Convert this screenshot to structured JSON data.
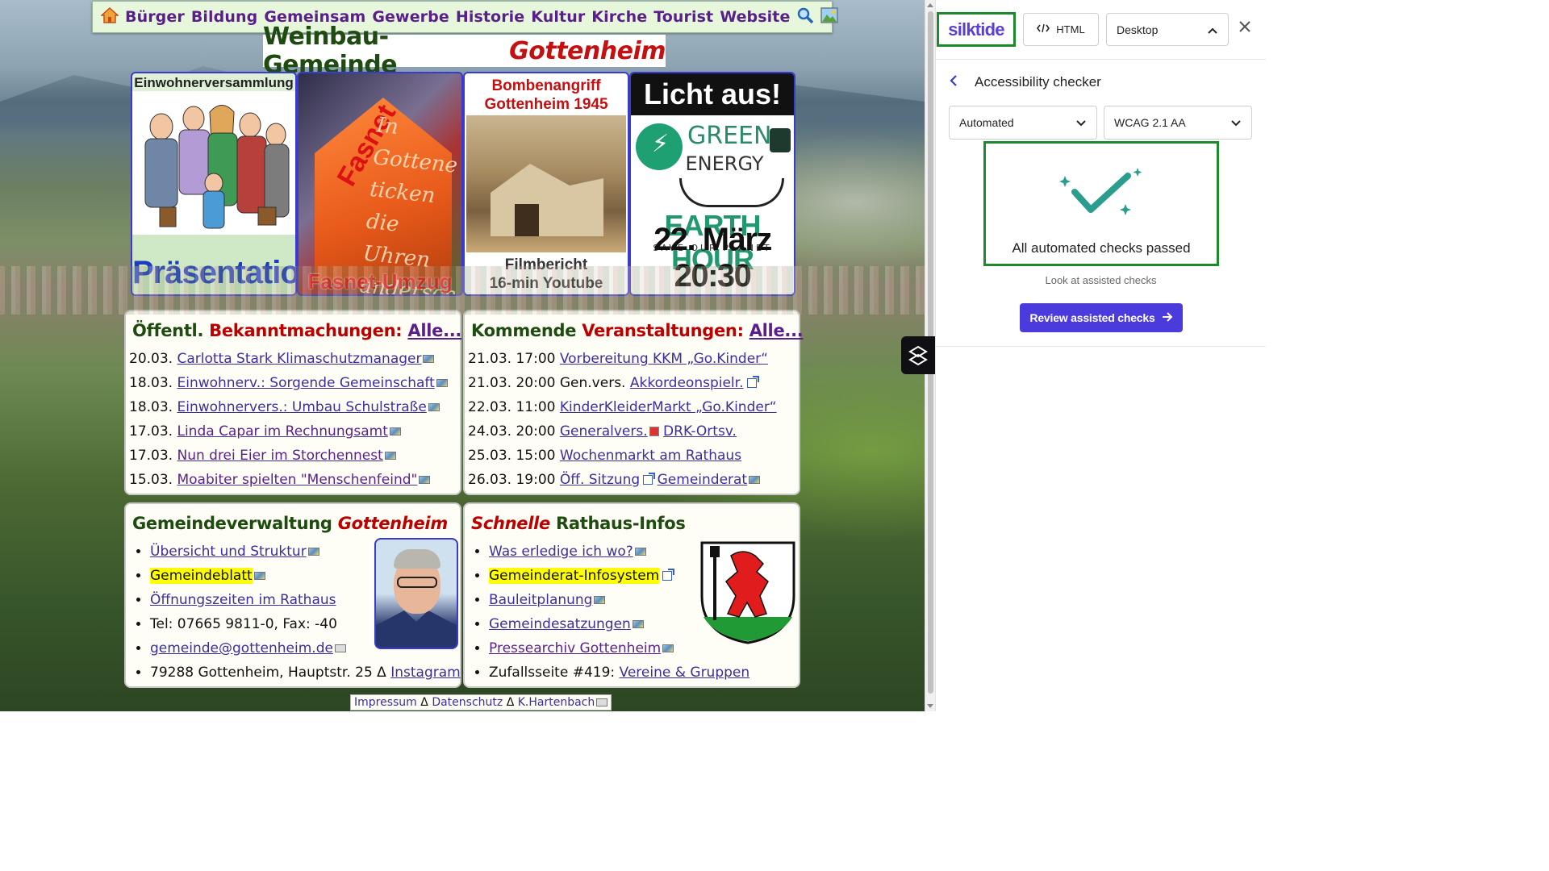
{
  "site": {
    "nav": {
      "home_icon": "home-icon",
      "items": [
        "Bürger",
        "Bildung",
        "Gemeinsam",
        "Gewerbe",
        "Historie",
        "Kultur",
        "Kirche",
        "Tourist",
        "Website"
      ],
      "search_icon": "search-icon",
      "image_icon": "image-icon"
    },
    "title": {
      "main": "Weinbau-Gemeinde",
      "accent": "Gottenheim"
    },
    "tiles": [
      {
        "head": "Einwohnerversammlung",
        "foot": "Präsentation"
      },
      {
        "diag": "Fasnet",
        "text": [
          "In",
          "Gottene",
          "ticken",
          "die Uhren",
          "andersch"
        ],
        "foot": "Fasnet-Umzug"
      },
      {
        "head": "Bombenangriff Gottenheim 1945",
        "foot1": "Filmbericht",
        "foot2": "16-min Youtube"
      },
      {
        "head": "Licht aus!",
        "green": "GREEN",
        "energy": "ENERGY",
        "earth": "EARTH HOUR",
        "save": "SAVE OUR PLANET",
        "foot": "22. März 20:30"
      }
    ],
    "news": {
      "title_a": "Öffentl.",
      "title_b": "Bekanntmachungen:",
      "all": "Alle...",
      "rows": [
        {
          "date": "20.03.",
          "text": "Carlotta Stark Klimaschutzmanager"
        },
        {
          "date": "18.03.",
          "text": "Einwohnerv.: Sorgende Gemeinschaft"
        },
        {
          "date": "18.03.",
          "text": "Einwohnervers.: Umbau Schulstraße"
        },
        {
          "date": "17.03.",
          "text": "Linda Capar im Rechnungsamt"
        },
        {
          "date": "17.03.",
          "text": "Nun drei Eier im Storchennest"
        },
        {
          "date": "15.03.",
          "text": "Moabiter spielten \"Menschenfeind\""
        }
      ]
    },
    "events": {
      "title_a": "Kommende",
      "title_b": "Veranstaltungen:",
      "all": "Alle...",
      "rows": [
        {
          "date": "21.03. 17:00",
          "text": "Vorbereitung KKM „Go.Kinder“"
        },
        {
          "date": "21.03. 20:00",
          "pre": "Gen.vers.",
          "text": "Akkordeonspielr."
        },
        {
          "date": "22.03. 11:00",
          "text": "KinderKleiderMarkt „Go.Kinder“"
        },
        {
          "date": "24.03. 20:00",
          "text": "Generalvers.",
          "text2": "DRK-Ortsv."
        },
        {
          "date": "25.03. 15:00",
          "text": "Wochenmarkt am Rathaus"
        },
        {
          "date": "26.03. 19:00",
          "text": "Öff. Sitzung",
          "text2": "Gemeinderat"
        }
      ]
    },
    "admin": {
      "title_a": "Gemeindeverwaltung",
      "title_b": "Gottenheim",
      "items": [
        "Übersicht und Struktur",
        "Gemeindeblatt",
        "Öffnungszeiten im Rathaus",
        "Tel: 07665 9811-0, Fax: -40",
        "gemeinde@gottenheim.de",
        "79288 Gottenheim, Hauptstr. 25 Δ",
        "Instagram"
      ]
    },
    "quick": {
      "title_a": "Schnelle",
      "title_b": "Rathaus-Infos",
      "items": [
        "Was erledige ich wo?",
        "Gemeinderat-Infosystem",
        "Bauleitplanung",
        "Gemeindesatzungen",
        "Pressearchiv Gottenheim",
        "Zufallsseite #419:",
        "Vereine & Gruppen"
      ]
    },
    "footer": {
      "impressum": "Impressum",
      "sep": "Δ",
      "datenschutz": "Datenschutz",
      "author": "K.Hartenbach"
    }
  },
  "panel": {
    "brand": "silktide",
    "html_label": "HTML",
    "device": "Desktop",
    "title": "Accessibility checker",
    "mode": "Automated",
    "standard": "WCAG 2.1 AA",
    "result": "All automated checks passed",
    "hint": "Look at assisted checks",
    "review": "Review assisted checks"
  },
  "colors": {
    "brand_purple": "#5a3fd6",
    "review_button": "#4b3bdc",
    "highlight_green": "#1b8a2a",
    "check_teal": "#2a9d8f",
    "title_red": "#c41010",
    "title_green": "#1e4b10"
  }
}
